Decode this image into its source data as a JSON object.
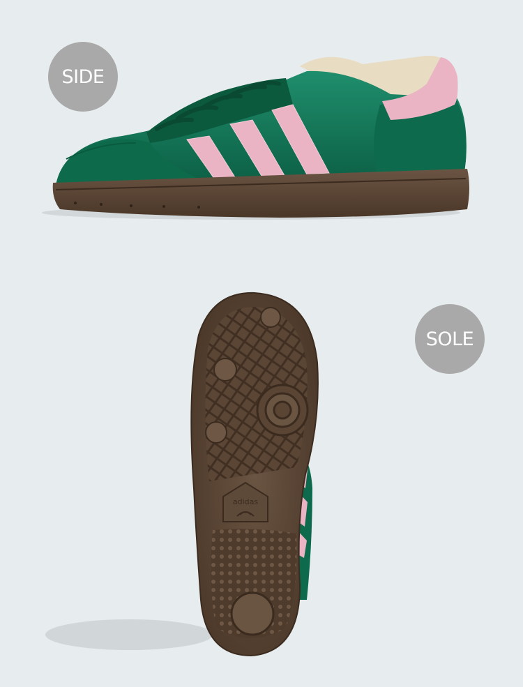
{
  "labels": {
    "side": "SIDE",
    "sole": "SOLE"
  },
  "sole_logo_text": "adidas",
  "colors": {
    "background": "#e7ecee",
    "badge": "#a9a9a9",
    "badge_text": "#ffffff",
    "upper_green": "#147a5b",
    "suede_green": "#0e6a4c",
    "stripe_pink": "#eab4c4",
    "gum_sole": "#5a4636",
    "liner_cream": "#e8dcc2"
  }
}
